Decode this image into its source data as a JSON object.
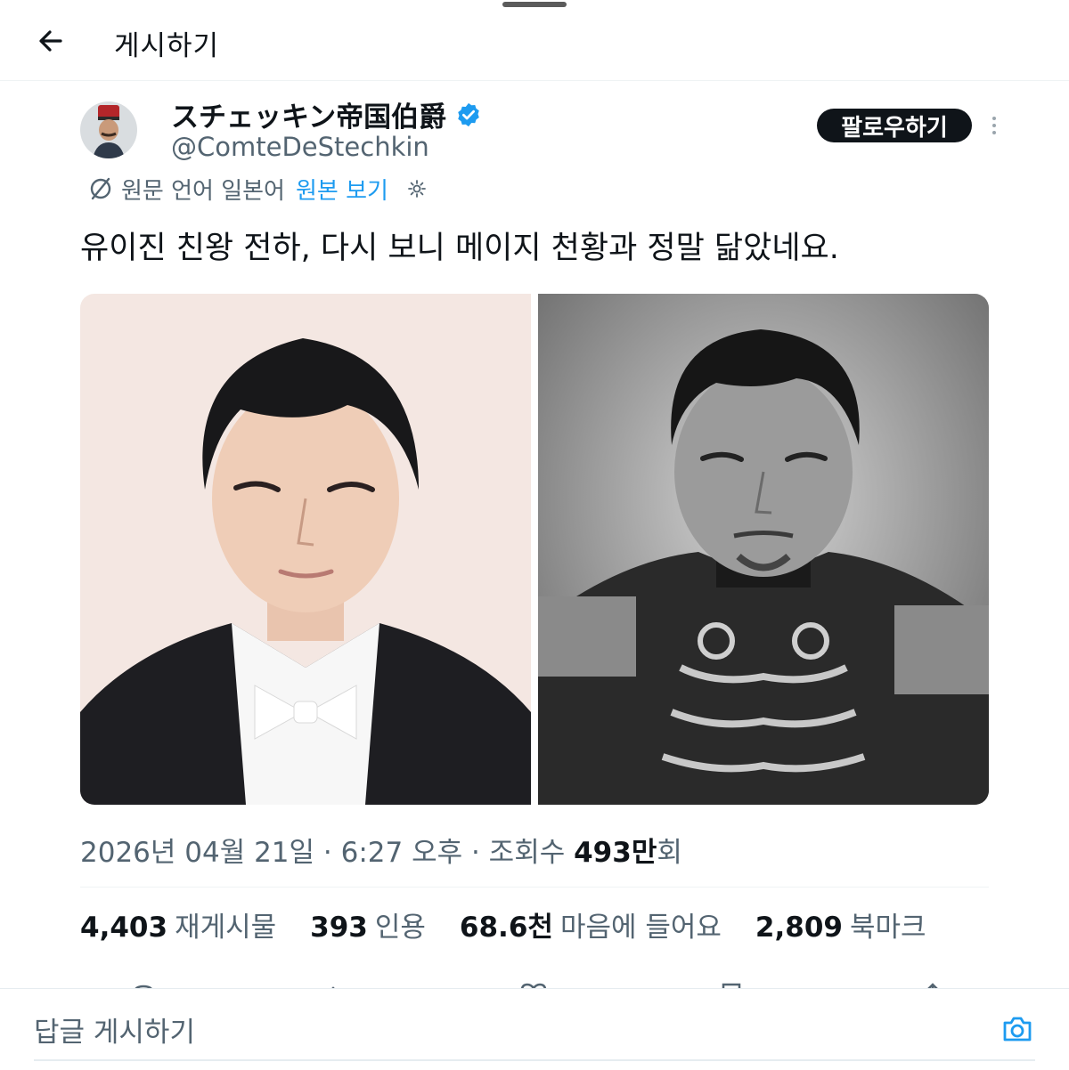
{
  "header": {
    "title": "게시하기",
    "back_icon": "arrow-left-icon"
  },
  "author": {
    "display_name": "スチェッキン帝国伯爵",
    "handle": "@ComteDeStechkin",
    "verified": true,
    "follow_label": "팔로우하기"
  },
  "translation": {
    "note": "원문 언어 일본어",
    "view_original": "원본 보기"
  },
  "post": {
    "text": "유이진 친왕 전하, 다시 보니 메이지 천황과 정말 닮았네요.",
    "timestamp": "2026년 04월 21일 · 6:27 오후 · 조회수 ",
    "views_num": "493만",
    "views_suffix": "회"
  },
  "stats": [
    {
      "value": "4,403",
      "label": "재게시물"
    },
    {
      "value": "393",
      "label": "인용"
    },
    {
      "value": "68.6천",
      "label": "마음에 들어요"
    },
    {
      "value": "2,809",
      "label": "북마크"
    }
  ],
  "reply": {
    "placeholder": "답글 게시하기"
  },
  "colors": {
    "accent": "#1d9bf0",
    "text": "#0f1419",
    "muted": "#536471"
  }
}
